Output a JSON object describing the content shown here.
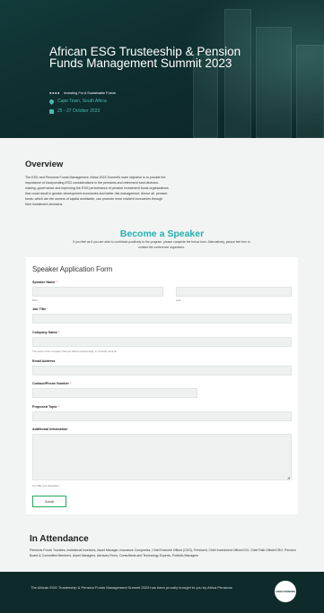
{
  "hero": {
    "title": "African ESG Trusteeship & Pension Funds Management Summit 2023",
    "tagline": "Investing For A Sustainable Future",
    "location": "Cape Town, South Africa",
    "dates": "25 - 27 October 2023",
    "accent_color": "#4db8b3",
    "bg_color": "#0f2f30"
  },
  "overview": {
    "heading": "Overview",
    "text": "The ESG and Pensions Funds Management, Africa 2023 Summit's main objective is to provide the importance of incorporating ESG considerations in the pensions and retirement fund decision-making, governance and improving the ESG performance of pension investment funds organizations that could result in greater development economies and better risk management. Above all, pension funds, which are the owners of capital worldwide, can promote more resilient economies through their investment decisions."
  },
  "speaker": {
    "heading": "Become a Speaker",
    "subtext": "If you feel as if you are able to contribute positively to the program, please complete the below form. Alternatively, please feel free to contact the conference organisers.",
    "heading_color": "#26b0b0"
  },
  "form": {
    "title": "Speaker Application Form",
    "name_label": "Speaker Name",
    "first_label": "First",
    "last_label": "Last",
    "job_label": "Job Title",
    "company_label": "Company Name",
    "company_hint": "The name of the company that you will be representing, or currently work at.",
    "email_label": "Email Address",
    "phone_label": "Contact/Phone Number",
    "topic_label": "Proposed Topic",
    "info_label": "Additional Information",
    "char_count": "0 of 350 max characters",
    "submit_label": "Submit",
    "required_mark": "*",
    "required_color": "#ee3344",
    "submit_border_color": "#26a85d"
  },
  "attendance": {
    "heading": "In Attendance",
    "text": "Pensions Funds Trustees, Insitutional Investors, Asset Manager, Insurance Companies, Chief Executie Officer (CEO), Presisent, Chief Investment Officer/CIO, Chief Risk Officer/CRO, Pension Board & Committee Members, Asset Managers, Advisory Firms, Consultants and Technology Experts, Portfolio Managers"
  },
  "footer": {
    "text": "The African ESG Trusteeship & Pension Funds Management Summit 2023 has been proudly brought to you by Africa Pensions",
    "logo_text": "AFRICA PENSIONS"
  }
}
